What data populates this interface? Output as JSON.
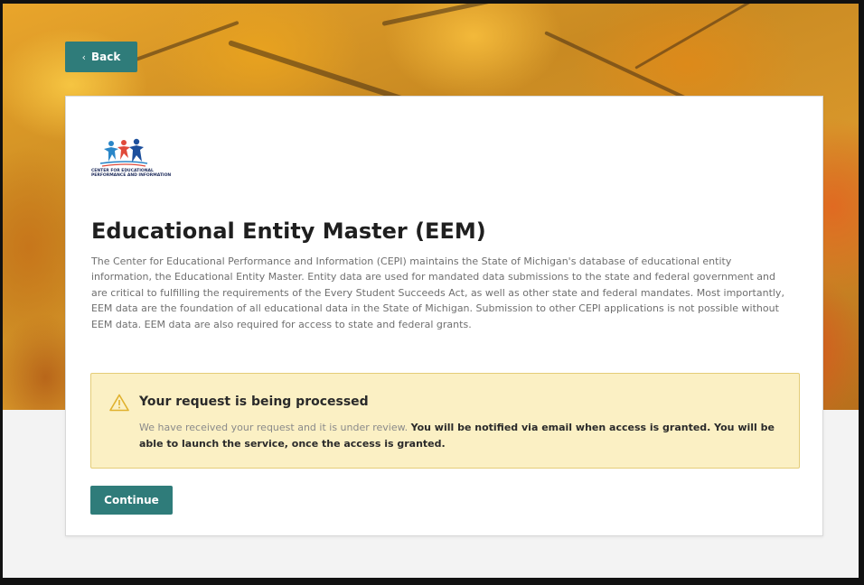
{
  "nav": {
    "back_label": "Back"
  },
  "logo": {
    "caption": "CENTER FOR EDUCATIONAL\nPERFORMANCE AND INFORMATION"
  },
  "page": {
    "title": "Educational Entity Master (EEM)",
    "description": "The Center for Educational Performance and Information (CEPI) maintains the State of Michigan's database of educational entity information, the Educational Entity Master. Entity data are used for mandated data submissions to the state and federal government and are critical to fulfilling the requirements of the Every Student Succeeds Act, as well as other state and federal mandates. Most importantly, EEM data are the foundation of all educational data in the State of Michigan. Submission to other CEPI applications is not possible without EEM data. EEM data are also required for access to state and federal grants."
  },
  "alert": {
    "icon": "warning-icon",
    "title": "Your request is being processed",
    "body_intro": "We have received your request and it is under review. ",
    "body_bold": "You will be notified via email when access is granted. You will be able to launch the service, once the access is granted."
  },
  "actions": {
    "continue_label": "Continue"
  },
  "colors": {
    "accent": "#2f7c7a",
    "alert_bg": "#fbf0c4",
    "alert_border": "#e4cc78",
    "warning_icon": "#e0b12e"
  }
}
